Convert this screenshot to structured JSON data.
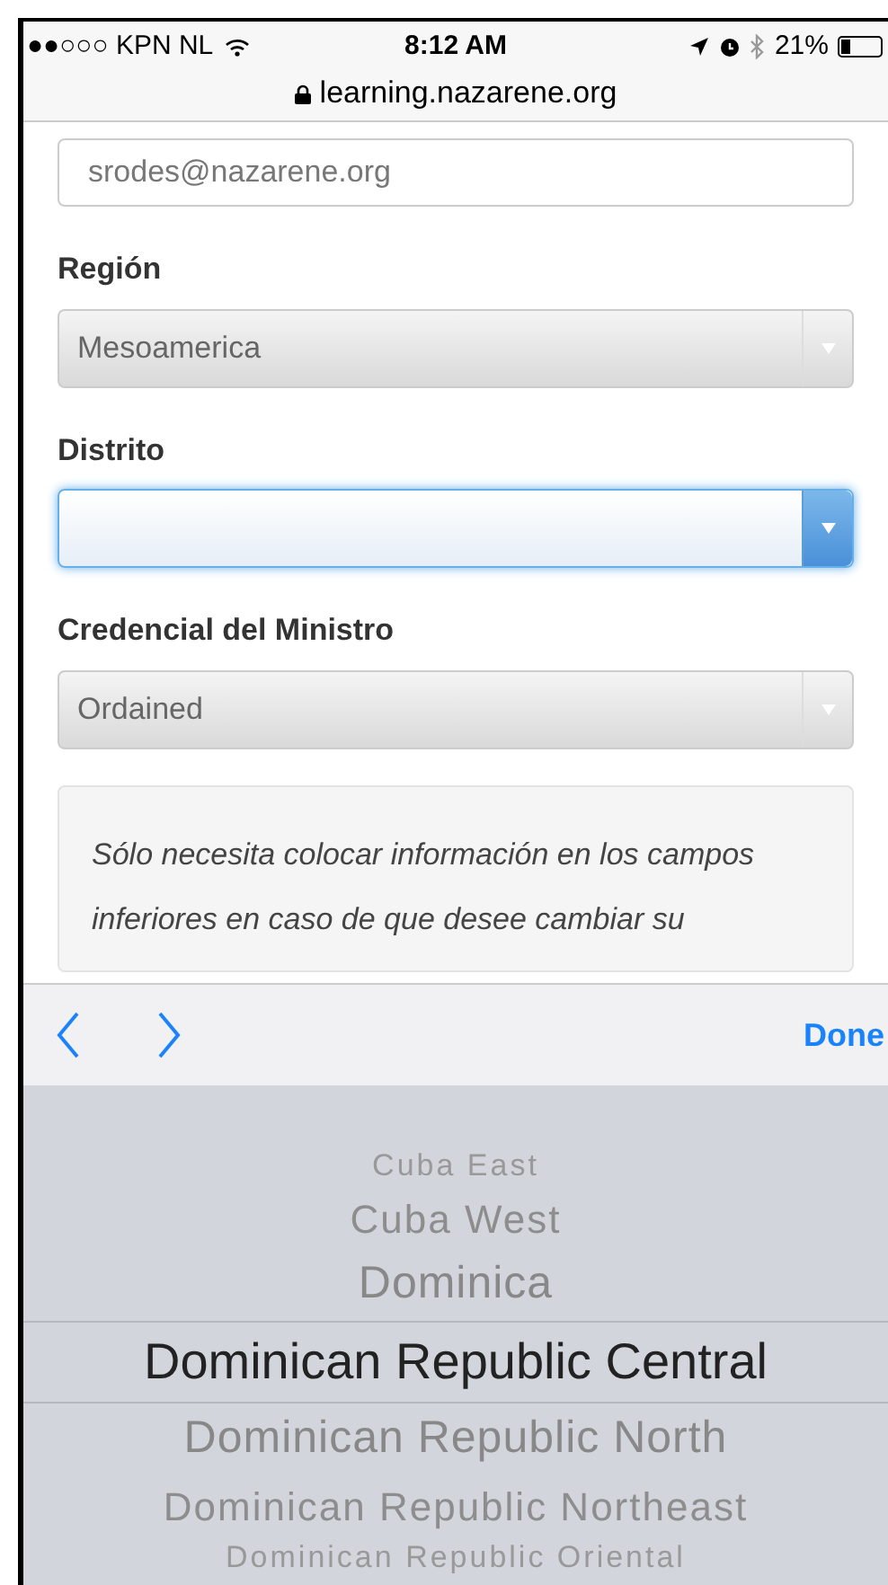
{
  "status_bar": {
    "carrier": "●●○○○ KPN NL",
    "time": "8:12 AM",
    "battery": "21%",
    "url": "learning.nazarene.org"
  },
  "form": [
    {
      "kind": "input",
      "value": "srodes@nazarene.org"
    },
    {
      "kind": "select",
      "label": "Región",
      "value": "Mesoamerica",
      "focused": false
    },
    {
      "kind": "select",
      "label": "Distrito",
      "focused": true
    },
    {
      "kind": "select",
      "label": "Credencial del Ministro",
      "value": "Ordained",
      "focused": false
    }
  ],
  "note": "Sólo necesita colocar información en los campos inferiores en caso de que desee cambiar su",
  "toolbar": {
    "done": "Done"
  },
  "picker": [
    {
      "label": "Cuba East",
      "selected": false
    },
    {
      "label": "Cuba West",
      "selected": false
    },
    {
      "label": "Dominica",
      "selected": false
    },
    {
      "label": "Dominican Republic Central",
      "selected": true
    },
    {
      "label": "Dominican Republic North",
      "selected": false
    },
    {
      "label": "Dominican Republic Northeast",
      "selected": false
    },
    {
      "label": "Dominican Republic Oriental",
      "selected": false
    }
  ]
}
